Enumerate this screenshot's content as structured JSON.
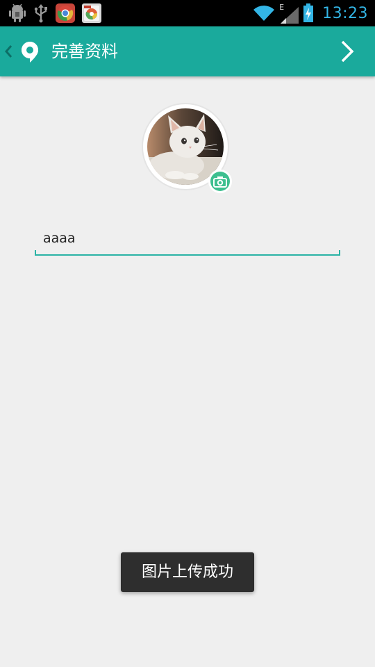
{
  "status_bar": {
    "time": "13:23",
    "network_type": "E",
    "icons": [
      "android-debug-icon",
      "usb-icon",
      "chrome-icon",
      "app-notification-icon",
      "wifi-icon",
      "signal-icon",
      "battery-charging-icon"
    ]
  },
  "app_bar": {
    "title": "完善资料",
    "background_color": "#1aaa9c"
  },
  "profile": {
    "nickname_value": "aaaa"
  },
  "toast": {
    "message": "图片上传成功"
  },
  "colors": {
    "accent": "#1aaa9c",
    "camera_badge": "#3dbf8f",
    "status_time": "#33b5e5"
  }
}
